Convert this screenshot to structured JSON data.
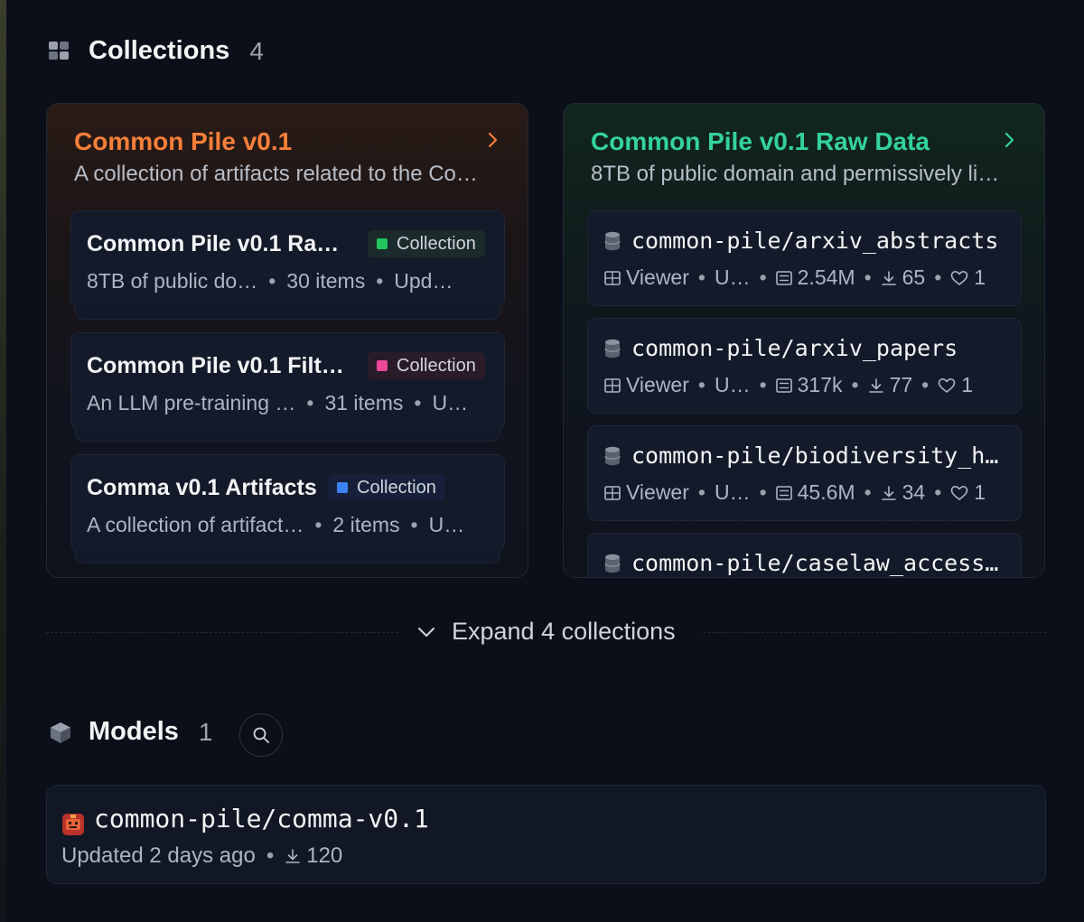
{
  "collections_section": {
    "title": "Collections",
    "count": "4",
    "icon": "collection-grid-icon"
  },
  "collections": [
    {
      "title": "Common Pile v0.1",
      "description": "A collection of artifacts related to the Co…",
      "accent": "#f97f3a",
      "items": [
        {
          "title": "Common Pile v0.1 Ra…",
          "badge": "Collection",
          "badge_color": "#22c55e",
          "desc": "8TB of public do…",
          "items": "30 items",
          "updated": "Upd…"
        },
        {
          "title": "Common Pile v0.1 Filt…",
          "badge": "Collection",
          "badge_color": "#ec4899",
          "desc": "An LLM pre-training …",
          "items": "31 items",
          "updated": "U…"
        },
        {
          "title": "Comma v0.1 Artifacts",
          "badge": "Collection",
          "badge_color": "#3b82f6",
          "desc": "A collection of artifact…",
          "items": "2 items",
          "updated": "U…"
        }
      ]
    },
    {
      "title": "Common Pile v0.1 Raw Data",
      "description": "8TB of public domain and permissively li…",
      "accent": "#34d399",
      "datasets": [
        {
          "name": "common-pile/arxiv_abstracts",
          "viewer": "Viewer",
          "updated": "U…",
          "rows": "2.54M",
          "downloads": "65",
          "likes": "1"
        },
        {
          "name": "common-pile/arxiv_papers",
          "viewer": "Viewer",
          "updated": "U…",
          "rows": "317k",
          "downloads": "77",
          "likes": "1"
        },
        {
          "name": "common-pile/biodiversity_h…",
          "viewer": "Viewer",
          "updated": "U…",
          "rows": "45.6M",
          "downloads": "34",
          "likes": "1"
        },
        {
          "name": "common-pile/caselaw_access…"
        }
      ]
    }
  ],
  "expand": {
    "label": "Expand 4 collections"
  },
  "models_section": {
    "title": "Models",
    "count": "1",
    "icon": "model-cube-icon"
  },
  "models": [
    {
      "name": "common-pile/comma-v0.1",
      "updated": "Updated 2 days ago",
      "downloads": "120"
    }
  ]
}
